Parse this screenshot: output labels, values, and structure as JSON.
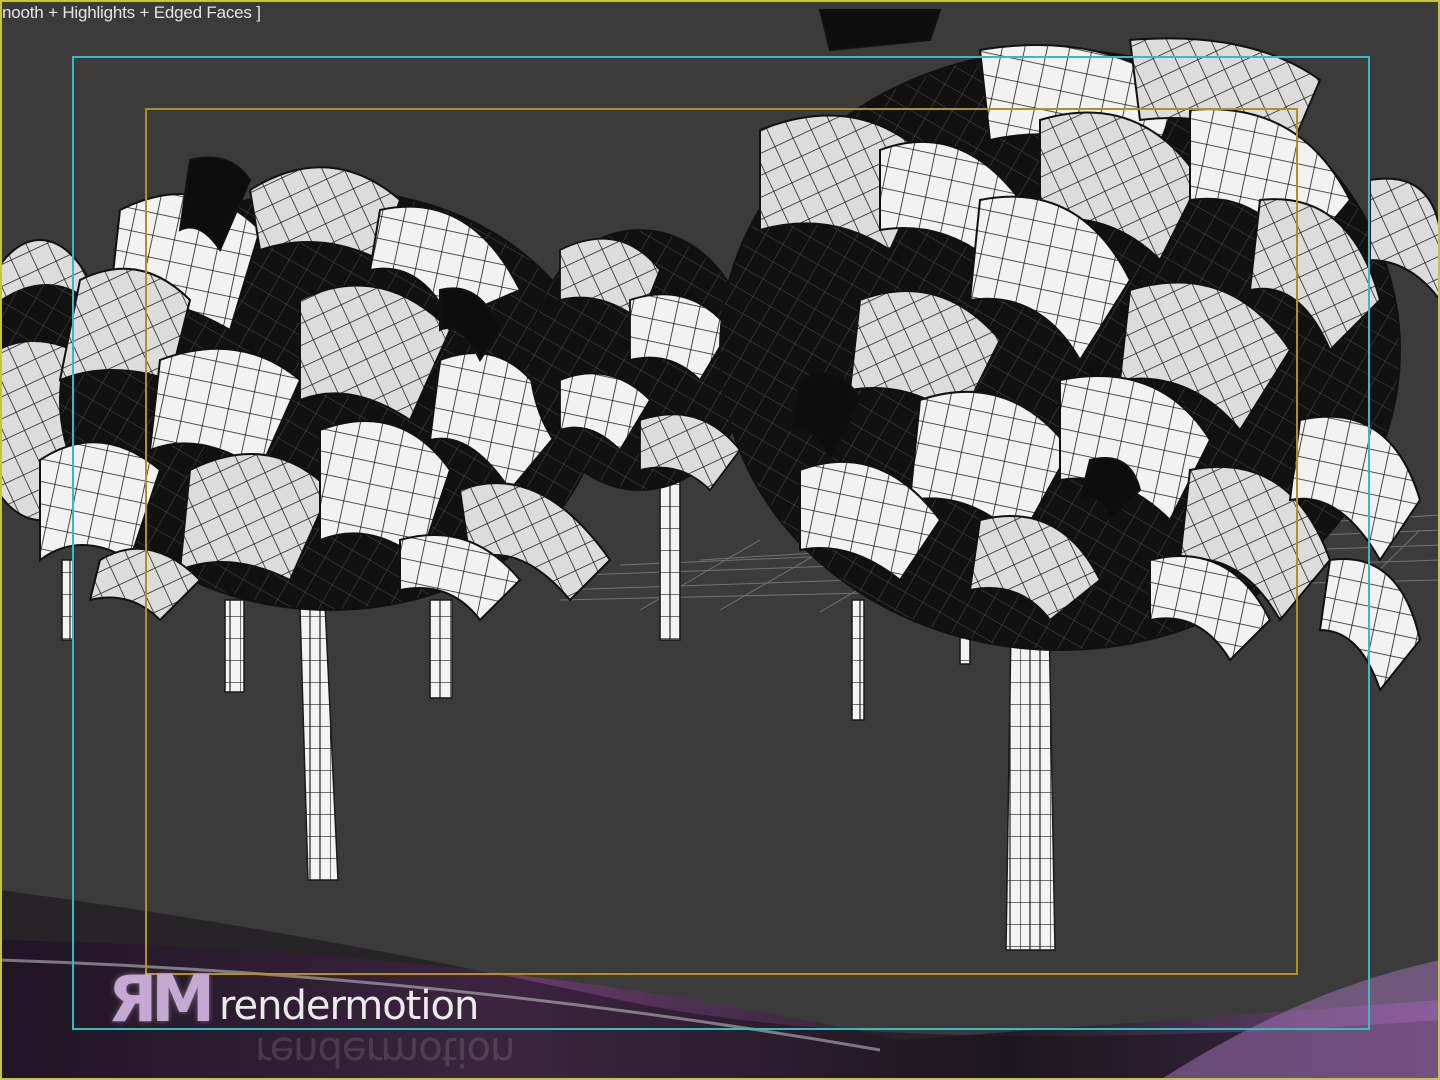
{
  "viewport": {
    "label": "nooth + Highlights + Edged Faces ]",
    "border_color": "#c6c63a",
    "background": "#3b3b3b"
  },
  "safe_frames": {
    "outer_color": "#33bcc4",
    "inner_color": "#b38f22"
  },
  "scene": {
    "objects": [
      "tree",
      "tree",
      "tree",
      "tree",
      "tree",
      "tree",
      "tree",
      "ground-grid"
    ]
  },
  "watermark": {
    "brand_mark": "ЯM",
    "brand_name": "rendermotion",
    "band_color": "#6d3b73"
  }
}
